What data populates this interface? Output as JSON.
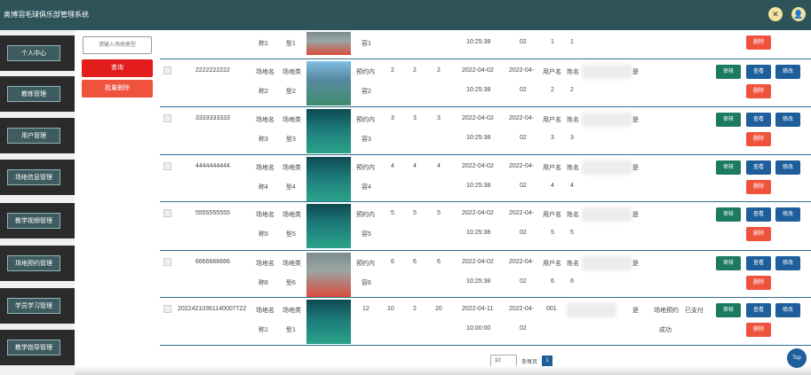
{
  "app": {
    "title": "奥博羽毛球俱乐部管理系统"
  },
  "header_icons": [
    "cross-arrows-icon",
    "user-icon"
  ],
  "sidebar": {
    "items": [
      {
        "label": "个人中心"
      },
      {
        "label": "教练管理"
      },
      {
        "label": "用户管理"
      },
      {
        "label": "场地信息管理"
      },
      {
        "label": "教学视频管理"
      },
      {
        "label": "场地预约管理"
      },
      {
        "label": "学员学习管理"
      },
      {
        "label": "教学指导管理"
      }
    ]
  },
  "controls": {
    "search_placeholder": "请输入场地类型",
    "query_label": "查询",
    "batch_delete_label": "批量删除"
  },
  "table": {
    "actions": {
      "audit": "审核",
      "view": "查看",
      "edit": "修改",
      "delete": "删除"
    },
    "top_partial": {
      "col1": "称1",
      "col2": "型1",
      "col3": "容1",
      "time": "10:25:38",
      "col5": "02",
      "n1": "1",
      "n2": "1"
    },
    "rows": [
      {
        "id": "2222222222",
        "name1": "场地名",
        "name2": "称2",
        "type1": "场地类",
        "type2": "型2",
        "c1": "预约内",
        "c2": "容2",
        "a": "2",
        "b": "2",
        "c": "2",
        "date": "2022-04-02",
        "time": "10:25:38",
        "d1": "2022-04-",
        "d2": "02",
        "u1": "用户名",
        "u2": "2",
        "n1": "姓名",
        "n2": "2",
        "extra": "是"
      },
      {
        "id": "3333333333",
        "name1": "场地名",
        "name2": "称3",
        "type1": "场地类",
        "type2": "型3",
        "c1": "预约内",
        "c2": "容3",
        "a": "3",
        "b": "3",
        "c": "3",
        "date": "2022-04-02",
        "time": "10:25:38",
        "d1": "2022-04-",
        "d2": "02",
        "u1": "用户名",
        "u2": "3",
        "n1": "姓名",
        "n2": "3",
        "extra": "是"
      },
      {
        "id": "4444444444",
        "name1": "场地名",
        "name2": "称4",
        "type1": "场地类",
        "type2": "型4",
        "c1": "预约内",
        "c2": "容4",
        "a": "4",
        "b": "4",
        "c": "4",
        "date": "2022-04-02",
        "time": "10:25:38",
        "d1": "2022-04-",
        "d2": "02",
        "u1": "用户名",
        "u2": "4",
        "n1": "姓名",
        "n2": "4",
        "extra": "是"
      },
      {
        "id": "5555555555",
        "name1": "场地名",
        "name2": "称5",
        "type1": "场地类",
        "type2": "型5",
        "c1": "预约内",
        "c2": "容5",
        "a": "5",
        "b": "5",
        "c": "5",
        "date": "2022-04-02",
        "time": "10:25:38",
        "d1": "2022-04-",
        "d2": "02",
        "u1": "用户名",
        "u2": "5",
        "n1": "姓名",
        "n2": "5",
        "extra": "是"
      },
      {
        "id": "6666666666",
        "name1": "场地名",
        "name2": "称6",
        "type1": "场地类",
        "type2": "型6",
        "c1": "预约内",
        "c2": "容6",
        "a": "6",
        "b": "6",
        "c": "6",
        "date": "2022-04-02",
        "time": "10:25:38",
        "d1": "2022-04-",
        "d2": "02",
        "u1": "用户名",
        "u2": "6",
        "n1": "姓名",
        "n2": "6",
        "extra": "是"
      },
      {
        "id": "20224210361140007722",
        "name1": "场地名",
        "name2": "称1",
        "type1": "场地类",
        "type2": "型1",
        "c1": "12",
        "c2": "",
        "a": "10",
        "b": "2",
        "c": "20",
        "date": "2022-04-11",
        "time": "10:00:00",
        "d1": "2022-04-",
        "d2": "02",
        "u1": "001",
        "u2": "",
        "n1": "",
        "n2": "",
        "extra": "是",
        "status1": "场地预约",
        "status1b": "成功",
        "status2": "已支付"
      }
    ]
  },
  "pager": {
    "page_size": "10",
    "per_page_label": "条每页",
    "page": "1"
  },
  "top_button": "Top"
}
